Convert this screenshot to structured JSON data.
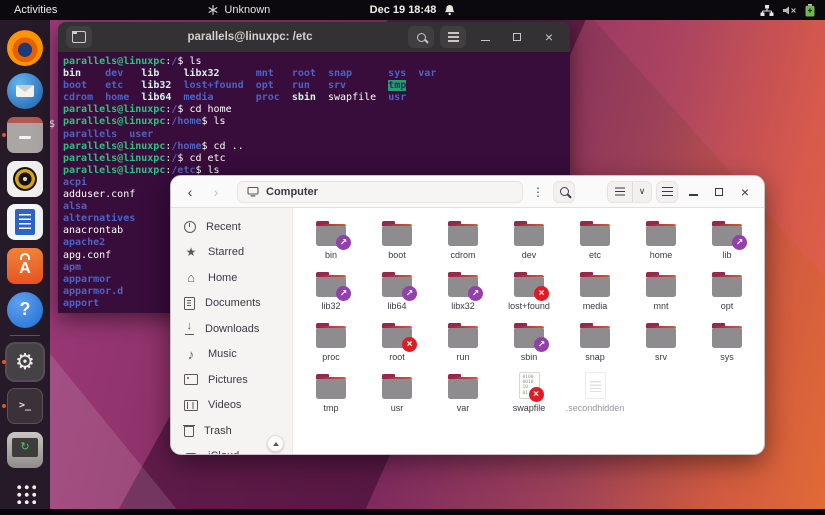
{
  "topbar": {
    "activities": "Activities",
    "focused_app": "Unknown",
    "clock": "Dec 19 18:48"
  },
  "artifact": {
    "stray_text": "$"
  },
  "dock": {
    "items": [
      {
        "name": "firefox",
        "running": false,
        "active": false
      },
      {
        "name": "thunderbird",
        "running": false,
        "active": false
      },
      {
        "name": "files",
        "running": true,
        "active": false
      },
      {
        "name": "rhythmbox",
        "running": false,
        "active": false
      },
      {
        "name": "libreoffice-writer",
        "running": false,
        "active": false
      },
      {
        "name": "ubuntu-software",
        "running": false,
        "active": false
      },
      {
        "name": "help",
        "running": false,
        "active": false
      },
      {
        "name": "settings",
        "running": true,
        "active": true
      },
      {
        "name": "terminal",
        "running": true,
        "active": false
      },
      {
        "name": "parallels-shared",
        "running": false,
        "active": false
      },
      {
        "name": "app-grid",
        "running": false,
        "active": false
      }
    ]
  },
  "terminal": {
    "title": "parallels@linuxpc: /etc",
    "lines": [
      [
        [
          "g",
          "parallels@linuxpc"
        ],
        [
          "w",
          ":"
        ],
        [
          "b",
          "/"
        ],
        [
          "w",
          "$ ls"
        ]
      ],
      [
        [
          "ln",
          "bin"
        ],
        [
          "w",
          "    "
        ],
        [
          "b",
          "dev"
        ],
        [
          "w",
          "   "
        ],
        [
          "ln",
          "lib"
        ],
        [
          "w",
          "    "
        ],
        [
          "ln",
          "libx32"
        ],
        [
          "w",
          "      "
        ],
        [
          "b",
          "mnt"
        ],
        [
          "w",
          "   "
        ],
        [
          "b",
          "root"
        ],
        [
          "w",
          "  "
        ],
        [
          "b",
          "snap"
        ],
        [
          "w",
          "      "
        ],
        [
          "b",
          "sys"
        ],
        [
          "w",
          "  "
        ],
        [
          "b",
          "var"
        ]
      ],
      [
        [
          "b",
          "boot"
        ],
        [
          "w",
          "   "
        ],
        [
          "b",
          "etc"
        ],
        [
          "w",
          "   "
        ],
        [
          "ln",
          "lib32"
        ],
        [
          "w",
          "  "
        ],
        [
          "b",
          "lost+found"
        ],
        [
          "w",
          "  "
        ],
        [
          "b",
          "opt"
        ],
        [
          "w",
          "   "
        ],
        [
          "b",
          "run"
        ],
        [
          "w",
          "   "
        ],
        [
          "b",
          "srv"
        ],
        [
          "w",
          "       "
        ],
        [
          "tmp",
          "tmp"
        ]
      ],
      [
        [
          "b",
          "cdrom"
        ],
        [
          "w",
          "  "
        ],
        [
          "b",
          "home"
        ],
        [
          "w",
          "  "
        ],
        [
          "ln",
          "lib64"
        ],
        [
          "w",
          "  "
        ],
        [
          "b",
          "media"
        ],
        [
          "w",
          "       "
        ],
        [
          "b",
          "proc"
        ],
        [
          "w",
          "  "
        ],
        [
          "ln",
          "sbin"
        ],
        [
          "w",
          "  "
        ],
        [
          "w",
          "swapfile"
        ],
        [
          "w",
          "  "
        ],
        [
          "b",
          "usr"
        ]
      ],
      [
        [
          "g",
          "parallels@linuxpc"
        ],
        [
          "w",
          ":"
        ],
        [
          "b",
          "/"
        ],
        [
          "w",
          "$ cd home"
        ]
      ],
      [
        [
          "g",
          "parallels@linuxpc"
        ],
        [
          "w",
          ":"
        ],
        [
          "b",
          "/home"
        ],
        [
          "w",
          "$ ls"
        ]
      ],
      [
        [
          "b",
          "parallels"
        ],
        [
          "w",
          "  "
        ],
        [
          "b",
          "user"
        ]
      ],
      [
        [
          "g",
          "parallels@linuxpc"
        ],
        [
          "w",
          ":"
        ],
        [
          "b",
          "/home"
        ],
        [
          "w",
          "$ cd .."
        ]
      ],
      [
        [
          "g",
          "parallels@linuxpc"
        ],
        [
          "w",
          ":"
        ],
        [
          "b",
          "/"
        ],
        [
          "w",
          "$ cd etc"
        ]
      ],
      [
        [
          "g",
          "parallels@linuxpc"
        ],
        [
          "w",
          ":"
        ],
        [
          "b",
          "/etc"
        ],
        [
          "w",
          "$ ls"
        ]
      ],
      [
        [
          "b",
          "acpi"
        ]
      ],
      [
        [
          "w",
          "adduser.conf"
        ]
      ],
      [
        [
          "b",
          "alsa"
        ]
      ],
      [
        [
          "b",
          "alternatives"
        ]
      ],
      [
        [
          "w",
          "anacrontab"
        ]
      ],
      [
        [
          "b",
          "apache2"
        ]
      ],
      [
        [
          "w",
          "apg.conf"
        ]
      ],
      [
        [
          "b",
          "apm"
        ]
      ],
      [
        [
          "b",
          "apparmor"
        ]
      ],
      [
        [
          "b",
          "apparmor.d"
        ]
      ],
      [
        [
          "b",
          "apport"
        ]
      ]
    ]
  },
  "files": {
    "location": "Computer",
    "sidebar": [
      {
        "icon": "clock-icon",
        "label": "Recent"
      },
      {
        "icon": "star-icon",
        "label": "Starred"
      },
      {
        "icon": "home-icon",
        "label": "Home"
      },
      {
        "icon": "doc-icon",
        "label": "Documents"
      },
      {
        "icon": "down-icon",
        "label": "Downloads"
      },
      {
        "icon": "music-icon",
        "label": "Music"
      },
      {
        "icon": "pic-icon",
        "label": "Pictures"
      },
      {
        "icon": "video-icon",
        "label": "Videos"
      },
      {
        "icon": "trash-icon",
        "label": "Trash"
      },
      {
        "icon": "cloud-icon",
        "label": "iCloud"
      }
    ],
    "grid": [
      {
        "label": "bin",
        "kind": "folder",
        "emblem": "link"
      },
      {
        "label": "boot",
        "kind": "folder",
        "emblem": ""
      },
      {
        "label": "cdrom",
        "kind": "folder",
        "emblem": ""
      },
      {
        "label": "dev",
        "kind": "folder",
        "emblem": ""
      },
      {
        "label": "etc",
        "kind": "folder",
        "emblem": ""
      },
      {
        "label": "home",
        "kind": "folder",
        "emblem": ""
      },
      {
        "label": "lib",
        "kind": "folder",
        "emblem": "link"
      },
      {
        "label": "lib32",
        "kind": "folder",
        "emblem": "link"
      },
      {
        "label": "lib64",
        "kind": "folder",
        "emblem": "link"
      },
      {
        "label": "libx32",
        "kind": "folder",
        "emblem": "link"
      },
      {
        "label": "lost+found",
        "kind": "folder",
        "emblem": "no-access"
      },
      {
        "label": "media",
        "kind": "folder",
        "emblem": ""
      },
      {
        "label": "mnt",
        "kind": "folder",
        "emblem": ""
      },
      {
        "label": "opt",
        "kind": "folder",
        "emblem": ""
      },
      {
        "label": "proc",
        "kind": "folder",
        "emblem": ""
      },
      {
        "label": "root",
        "kind": "folder",
        "emblem": "no-access"
      },
      {
        "label": "run",
        "kind": "folder",
        "emblem": ""
      },
      {
        "label": "sbin",
        "kind": "folder",
        "emblem": "link"
      },
      {
        "label": "snap",
        "kind": "folder",
        "emblem": ""
      },
      {
        "label": "srv",
        "kind": "folder",
        "emblem": ""
      },
      {
        "label": "sys",
        "kind": "folder",
        "emblem": ""
      },
      {
        "label": "tmp",
        "kind": "folder",
        "emblem": ""
      },
      {
        "label": "usr",
        "kind": "folder",
        "emblem": ""
      },
      {
        "label": "var",
        "kind": "folder",
        "emblem": ""
      },
      {
        "label": "swapfile",
        "kind": "binary-file",
        "emblem": "no-access"
      },
      {
        "label": ".secondhidden",
        "kind": "text-file",
        "emblem": "",
        "hidden": true
      }
    ],
    "binary_glyph": "0100\n0010\n10\n01"
  },
  "colors": {
    "accent_orange": "#e95420",
    "terminal_bg": "#380c3b",
    "prompt_green": "#2ec27e",
    "dir_blue": "#4f63c4",
    "symlink_cyan": "#d7f2ef",
    "tmp_bg_green": "#26a269",
    "emblem_purple": "#9141ac",
    "emblem_red": "#e01b24"
  }
}
